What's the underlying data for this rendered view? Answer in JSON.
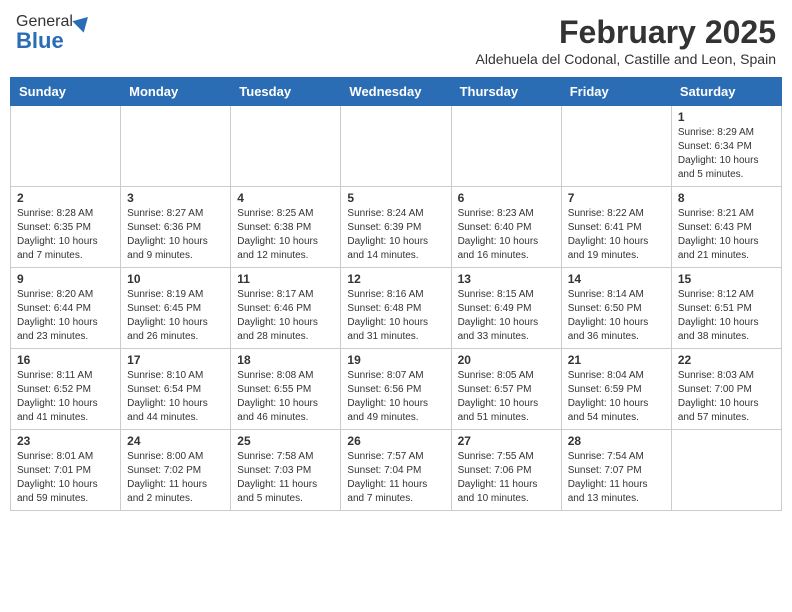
{
  "logo": {
    "general": "General",
    "blue": "Blue"
  },
  "title": {
    "month": "February 2025",
    "location": "Aldehuela del Codonal, Castille and Leon, Spain"
  },
  "weekdays": [
    "Sunday",
    "Monday",
    "Tuesday",
    "Wednesday",
    "Thursday",
    "Friday",
    "Saturday"
  ],
  "weeks": [
    [
      {
        "day": "",
        "info": ""
      },
      {
        "day": "",
        "info": ""
      },
      {
        "day": "",
        "info": ""
      },
      {
        "day": "",
        "info": ""
      },
      {
        "day": "",
        "info": ""
      },
      {
        "day": "",
        "info": ""
      },
      {
        "day": "1",
        "info": "Sunrise: 8:29 AM\nSunset: 6:34 PM\nDaylight: 10 hours and 5 minutes."
      }
    ],
    [
      {
        "day": "2",
        "info": "Sunrise: 8:28 AM\nSunset: 6:35 PM\nDaylight: 10 hours and 7 minutes."
      },
      {
        "day": "3",
        "info": "Sunrise: 8:27 AM\nSunset: 6:36 PM\nDaylight: 10 hours and 9 minutes."
      },
      {
        "day": "4",
        "info": "Sunrise: 8:25 AM\nSunset: 6:38 PM\nDaylight: 10 hours and 12 minutes."
      },
      {
        "day": "5",
        "info": "Sunrise: 8:24 AM\nSunset: 6:39 PM\nDaylight: 10 hours and 14 minutes."
      },
      {
        "day": "6",
        "info": "Sunrise: 8:23 AM\nSunset: 6:40 PM\nDaylight: 10 hours and 16 minutes."
      },
      {
        "day": "7",
        "info": "Sunrise: 8:22 AM\nSunset: 6:41 PM\nDaylight: 10 hours and 19 minutes."
      },
      {
        "day": "8",
        "info": "Sunrise: 8:21 AM\nSunset: 6:43 PM\nDaylight: 10 hours and 21 minutes."
      }
    ],
    [
      {
        "day": "9",
        "info": "Sunrise: 8:20 AM\nSunset: 6:44 PM\nDaylight: 10 hours and 23 minutes."
      },
      {
        "day": "10",
        "info": "Sunrise: 8:19 AM\nSunset: 6:45 PM\nDaylight: 10 hours and 26 minutes."
      },
      {
        "day": "11",
        "info": "Sunrise: 8:17 AM\nSunset: 6:46 PM\nDaylight: 10 hours and 28 minutes."
      },
      {
        "day": "12",
        "info": "Sunrise: 8:16 AM\nSunset: 6:48 PM\nDaylight: 10 hours and 31 minutes."
      },
      {
        "day": "13",
        "info": "Sunrise: 8:15 AM\nSunset: 6:49 PM\nDaylight: 10 hours and 33 minutes."
      },
      {
        "day": "14",
        "info": "Sunrise: 8:14 AM\nSunset: 6:50 PM\nDaylight: 10 hours and 36 minutes."
      },
      {
        "day": "15",
        "info": "Sunrise: 8:12 AM\nSunset: 6:51 PM\nDaylight: 10 hours and 38 minutes."
      }
    ],
    [
      {
        "day": "16",
        "info": "Sunrise: 8:11 AM\nSunset: 6:52 PM\nDaylight: 10 hours and 41 minutes."
      },
      {
        "day": "17",
        "info": "Sunrise: 8:10 AM\nSunset: 6:54 PM\nDaylight: 10 hours and 44 minutes."
      },
      {
        "day": "18",
        "info": "Sunrise: 8:08 AM\nSunset: 6:55 PM\nDaylight: 10 hours and 46 minutes."
      },
      {
        "day": "19",
        "info": "Sunrise: 8:07 AM\nSunset: 6:56 PM\nDaylight: 10 hours and 49 minutes."
      },
      {
        "day": "20",
        "info": "Sunrise: 8:05 AM\nSunset: 6:57 PM\nDaylight: 10 hours and 51 minutes."
      },
      {
        "day": "21",
        "info": "Sunrise: 8:04 AM\nSunset: 6:59 PM\nDaylight: 10 hours and 54 minutes."
      },
      {
        "day": "22",
        "info": "Sunrise: 8:03 AM\nSunset: 7:00 PM\nDaylight: 10 hours and 57 minutes."
      }
    ],
    [
      {
        "day": "23",
        "info": "Sunrise: 8:01 AM\nSunset: 7:01 PM\nDaylight: 10 hours and 59 minutes."
      },
      {
        "day": "24",
        "info": "Sunrise: 8:00 AM\nSunset: 7:02 PM\nDaylight: 11 hours and 2 minutes."
      },
      {
        "day": "25",
        "info": "Sunrise: 7:58 AM\nSunset: 7:03 PM\nDaylight: 11 hours and 5 minutes."
      },
      {
        "day": "26",
        "info": "Sunrise: 7:57 AM\nSunset: 7:04 PM\nDaylight: 11 hours and 7 minutes."
      },
      {
        "day": "27",
        "info": "Sunrise: 7:55 AM\nSunset: 7:06 PM\nDaylight: 11 hours and 10 minutes."
      },
      {
        "day": "28",
        "info": "Sunrise: 7:54 AM\nSunset: 7:07 PM\nDaylight: 11 hours and 13 minutes."
      },
      {
        "day": "",
        "info": ""
      }
    ]
  ]
}
